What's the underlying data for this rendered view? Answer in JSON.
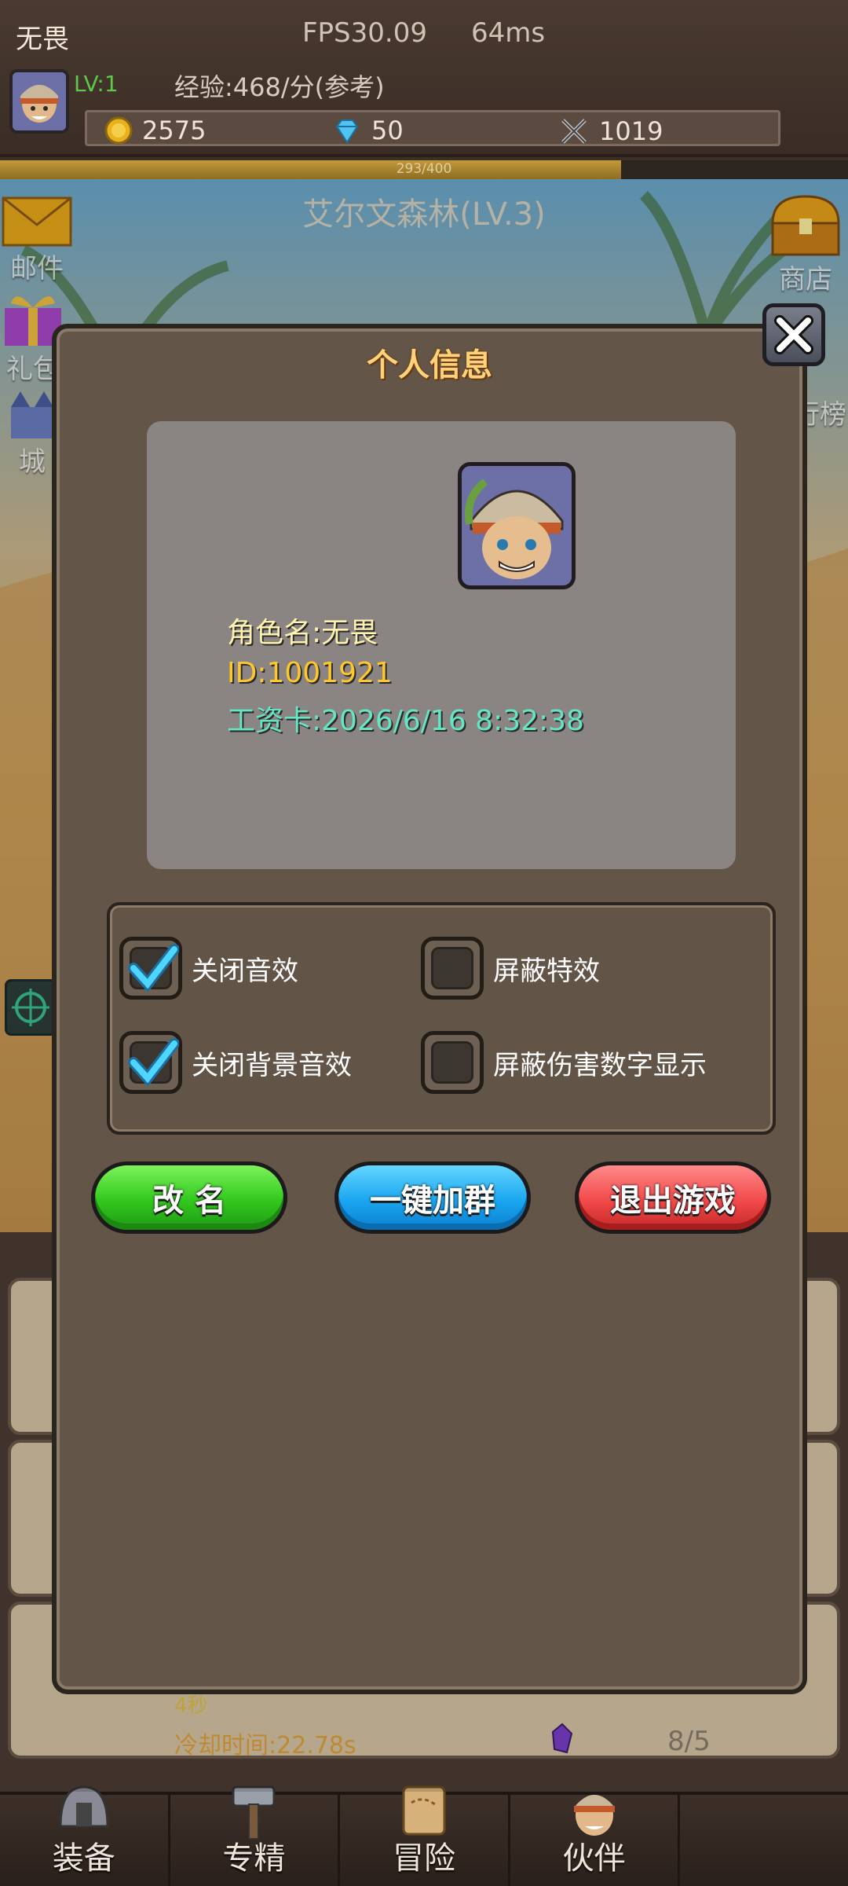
{
  "header": {
    "player_name": "无畏",
    "fps": "FPS30.09",
    "latency": "64ms",
    "level": "LV:1",
    "exp": "经验:468/分(参考)",
    "gold": "2575",
    "diamonds": "50",
    "power": "1019",
    "progress_text": "293/400",
    "progress_fraction": 0.7325
  },
  "scene": {
    "zone_title": "艾尔文森林(LV.3)",
    "mail_label": "邮件",
    "gift_label": "礼包",
    "castle_label": "城",
    "shop_label": "商店",
    "rank_label": "行榜"
  },
  "modal": {
    "title": "个人信息",
    "role_name": "角色名:无畏",
    "id": "ID:1001921",
    "salary_card": "工资卡:2026/6/16 8:32:38",
    "options": [
      {
        "label": "关闭音效",
        "checked": true
      },
      {
        "label": "屏蔽特效",
        "checked": false
      },
      {
        "label": "关闭背景音效",
        "checked": true
      },
      {
        "label": "屏蔽伤害数字显示",
        "checked": false
      }
    ],
    "rename_button": "改 名",
    "join_group_button": "一键加群",
    "exit_button": "退出游戏"
  },
  "background_list": {
    "seconds": "4秒",
    "cooldown": "冷却时间:22.78s",
    "count": "8/5"
  },
  "nav": {
    "equipment": "装备",
    "refine": "专精",
    "adventure": "冒险",
    "partner": "伙伴"
  }
}
